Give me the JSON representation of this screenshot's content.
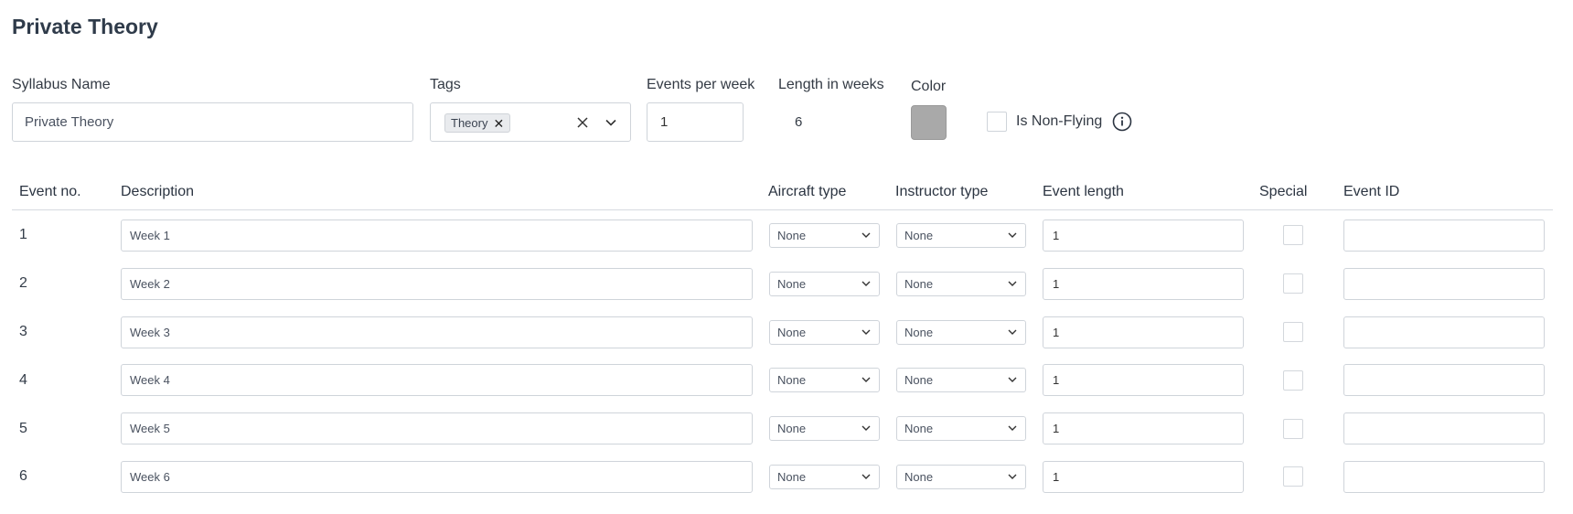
{
  "page_title": "Private Theory",
  "form": {
    "syllabus_name_label": "Syllabus Name",
    "syllabus_name_value": "Private Theory",
    "tags_label": "Tags",
    "tags": [
      "Theory"
    ],
    "events_per_week_label": "Events per week",
    "events_per_week_value": "1",
    "length_in_weeks_label": "Length in weeks",
    "length_in_weeks_value": "6",
    "color_label": "Color",
    "color_value": "#a9a9a9",
    "non_flying_label": "Is Non-Flying",
    "non_flying_checked": false
  },
  "table": {
    "headers": {
      "event_no": "Event no.",
      "description": "Description",
      "aircraft_type": "Aircraft type",
      "instructor_type": "Instructor type",
      "event_length": "Event length",
      "special": "Special",
      "event_id": "Event ID"
    },
    "rows": [
      {
        "no": "1",
        "description": "Week 1",
        "aircraft": "None",
        "instructor": "None",
        "length": "1",
        "special": false,
        "event_id": ""
      },
      {
        "no": "2",
        "description": "Week 2",
        "aircraft": "None",
        "instructor": "None",
        "length": "1",
        "special": false,
        "event_id": ""
      },
      {
        "no": "3",
        "description": "Week 3",
        "aircraft": "None",
        "instructor": "None",
        "length": "1",
        "special": false,
        "event_id": ""
      },
      {
        "no": "4",
        "description": "Week 4",
        "aircraft": "None",
        "instructor": "None",
        "length": "1",
        "special": false,
        "event_id": ""
      },
      {
        "no": "5",
        "description": "Week 5",
        "aircraft": "None",
        "instructor": "None",
        "length": "1",
        "special": false,
        "event_id": ""
      },
      {
        "no": "6",
        "description": "Week 6",
        "aircraft": "None",
        "instructor": "None",
        "length": "1",
        "special": false,
        "event_id": ""
      }
    ]
  },
  "icons": {
    "tag_remove": "close-icon",
    "clear": "close-icon",
    "dropdown": "chevron-down-icon",
    "info": "info-icon"
  }
}
